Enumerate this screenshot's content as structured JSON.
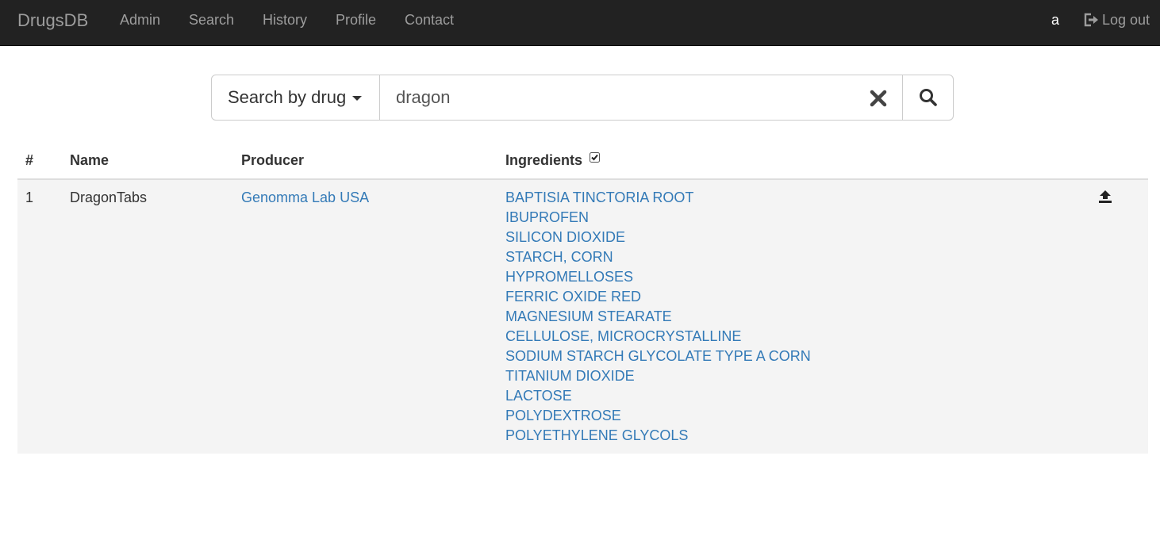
{
  "navbar": {
    "brand": "DrugsDB",
    "links": [
      "Admin",
      "Search",
      "History",
      "Profile",
      "Contact"
    ],
    "user": "a",
    "logout_label": "Log out"
  },
  "search": {
    "mode_label": "Search by drug",
    "query": "dragon"
  },
  "table": {
    "headers": {
      "index": "#",
      "name": "Name",
      "producer": "Producer",
      "ingredients": "Ingredients"
    },
    "ingredients_checkbox_checked": true,
    "rows": [
      {
        "index": "1",
        "name": "DragonTabs",
        "producer": "Genomma Lab USA",
        "ingredients": [
          "BAPTISIA TINCTORIA ROOT",
          "IBUPROFEN",
          "SILICON DIOXIDE",
          "STARCH, CORN",
          "HYPROMELLOSES",
          "FERRIC OXIDE RED",
          "MAGNESIUM STEARATE",
          "CELLULOSE, MICROCRYSTALLINE",
          "SODIUM STARCH GLYCOLATE TYPE A CORN",
          "TITANIUM DIOXIDE",
          "LACTOSE",
          "POLYDEXTROSE",
          "POLYETHYLENE GLYCOLS"
        ]
      }
    ]
  },
  "icons": {
    "logout": "logout-icon",
    "clear": "clear-icon",
    "search": "search-icon",
    "checkbox": "checkbox-icon",
    "upload": "upload-icon"
  },
  "colors": {
    "navbar_bg": "#222222",
    "nav_text": "#9d9d9d",
    "link": "#337ab7",
    "row_bg": "#f4f4f4"
  }
}
